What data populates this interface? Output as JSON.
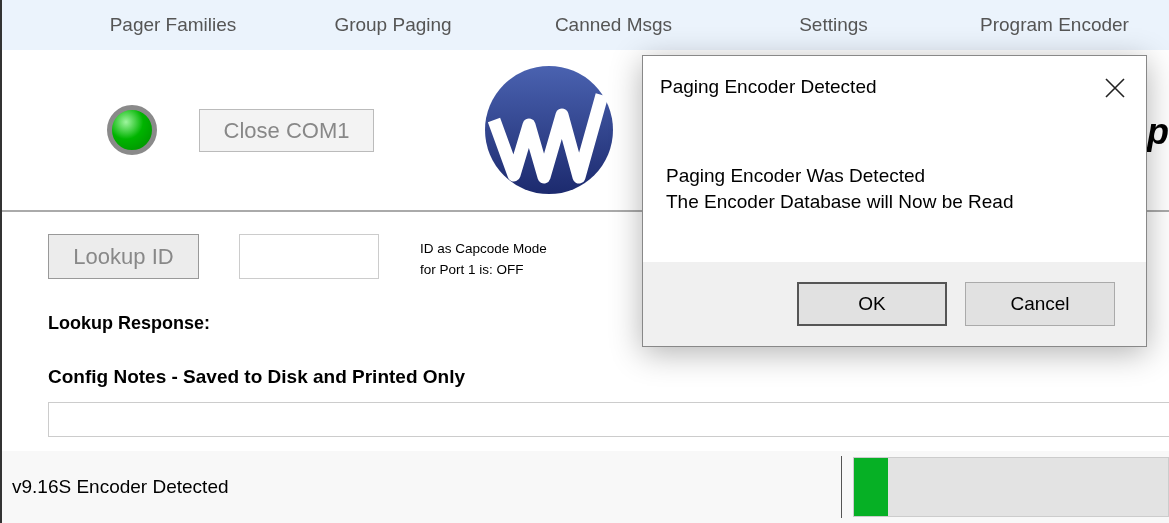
{
  "menu": [
    {
      "label": "Pager Families"
    },
    {
      "label": "Group Paging"
    },
    {
      "label": "Canned Msgs"
    },
    {
      "label": "Settings"
    },
    {
      "label": "Program Encoder"
    }
  ],
  "header": {
    "connected": true,
    "port_button": "Close COM1",
    "title": "p"
  },
  "lookup": {
    "button": "Lookup ID",
    "capcode_note": [
      "ID as Capcode Mode",
      "for Port 1 is: OFF"
    ],
    "response_label": "Lookup Response:"
  },
  "notes": {
    "label": "Config Notes - Saved to Disk and Printed Only"
  },
  "status_bar": {
    "text": "v9.16S Encoder Detected",
    "progress": {
      "level": 0.11
    }
  },
  "dialog": {
    "title": "Paging Encoder Detected",
    "message": [
      "Paging Encoder Was Detected",
      "The Encoder Database will Now be Read"
    ],
    "buttons": [
      "OK",
      "Cancel"
    ]
  }
}
